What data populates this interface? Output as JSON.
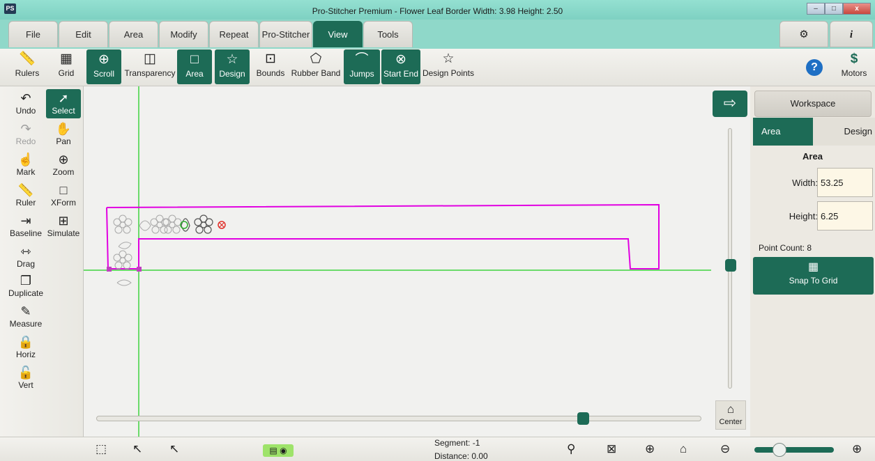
{
  "titlebar": {
    "app_icon": "PS",
    "title": "Pro-Stitcher Premium  -  Flower Leaf Border  Width: 3.98  Height: 2.50",
    "minimize": "–",
    "maximize": "□",
    "close": "x"
  },
  "menu": {
    "tabs": [
      "File",
      "Edit",
      "Area",
      "Modify",
      "Repeat",
      "Pro-Stitcher",
      "View",
      "Tools"
    ],
    "active": "View",
    "settings_icon": "gear-icon",
    "info_icon": "info-icon"
  },
  "toolbar": {
    "items": [
      {
        "label": "Rulers",
        "icon": "ruler-icon",
        "active": false
      },
      {
        "label": "Grid",
        "icon": "grid-icon",
        "active": false
      },
      {
        "label": "Scroll",
        "icon": "scroll-icon",
        "active": true
      },
      {
        "label": "Transparency",
        "icon": "transparency-icon",
        "active": false
      },
      {
        "label": "Area",
        "icon": "area-icon",
        "active": true
      },
      {
        "label": "Design",
        "icon": "design-icon",
        "active": true
      },
      {
        "label": "Bounds",
        "icon": "bounds-icon",
        "active": false
      },
      {
        "label": "Rubber Band",
        "icon": "rubber-band-icon",
        "active": false
      },
      {
        "label": "Jumps",
        "icon": "jumps-icon",
        "active": true
      },
      {
        "label": "Start End",
        "icon": "start-end-icon",
        "active": true
      },
      {
        "label": "Design Points",
        "icon": "design-points-icon",
        "active": false
      }
    ],
    "help_icon": "help-icon",
    "motors_label": "Motors"
  },
  "left_tools": [
    {
      "label": "Undo",
      "icon": "undo-icon",
      "state": "normal"
    },
    {
      "label": "Select",
      "icon": "select-icon",
      "state": "active"
    },
    {
      "label": "Redo",
      "icon": "redo-icon",
      "state": "disabled"
    },
    {
      "label": "Pan",
      "icon": "pan-icon",
      "state": "normal"
    },
    {
      "label": "Mark",
      "icon": "mark-icon",
      "state": "normal"
    },
    {
      "label": "Zoom",
      "icon": "zoom-icon",
      "state": "normal"
    },
    {
      "label": "Ruler",
      "icon": "ruler-icon",
      "state": "normal"
    },
    {
      "label": "XForm",
      "icon": "xform-icon",
      "state": "normal"
    },
    {
      "label": "Baseline",
      "icon": "baseline-icon",
      "state": "normal"
    },
    {
      "label": "Simulate",
      "icon": "simulate-icon",
      "state": "normal"
    },
    {
      "label": "Drag",
      "icon": "drag-icon",
      "state": "normal"
    },
    {
      "label": "Duplicate",
      "icon": "duplicate-icon",
      "state": "normal"
    },
    {
      "label": "Measure",
      "icon": "measure-icon",
      "state": "normal"
    },
    {
      "label": "Horiz",
      "icon": "horiz-icon",
      "state": "normal"
    },
    {
      "label": "Vert",
      "icon": "vert-icon",
      "state": "normal"
    }
  ],
  "canvas": {
    "arrow_icon": "arrow-right-icon",
    "center_label": "Center",
    "area_outline_color": "#e100e1",
    "guide_color": "#3fd43f"
  },
  "right_panel": {
    "workspace_label": "Workspace",
    "tabs": [
      "Area",
      "Design"
    ],
    "active_tab": "Area",
    "section_title": "Area",
    "width_label": "Width:",
    "width_value": "53.25",
    "height_label": "Height:",
    "height_value": "6.25",
    "point_count": "Point Count:  8",
    "snap_label": "Snap To Grid"
  },
  "statusbar": {
    "segment": "Segment: -1",
    "distance": "Distance: 0.00",
    "left_icons": [
      "select-box-icon",
      "move-corner-icon",
      "move-end-icon"
    ],
    "right_icons": [
      "zoom-fit-icon",
      "zoom-area-icon",
      "zoom-actual-icon",
      "home-icon",
      "zoom-out-icon",
      "zoom-in-icon"
    ]
  },
  "colors": {
    "accent": "#1d6b56",
    "chrome": "#8fd8c9"
  }
}
